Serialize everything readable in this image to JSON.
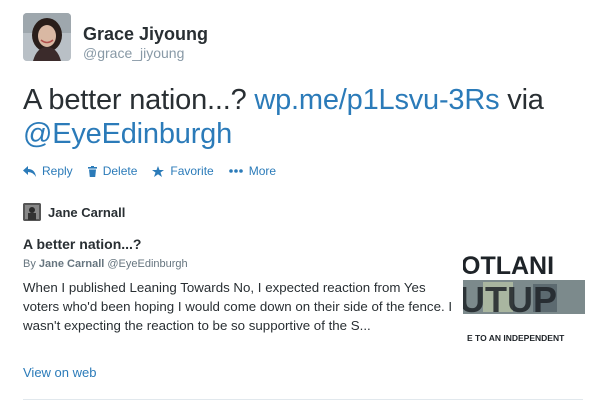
{
  "author": {
    "name": "Grace Jiyoung",
    "handle": "@grace_jiyoung"
  },
  "tweet": {
    "text_plain": "A better nation...? ",
    "link": "wp.me/p1Lsvu-3Rs",
    "via": " via ",
    "mention": "@EyeEdinburgh"
  },
  "actions": [
    {
      "label": "Reply",
      "icon": "reply-icon"
    },
    {
      "label": "Delete",
      "icon": "trash-icon"
    },
    {
      "label": "Favorite",
      "icon": "star-icon"
    },
    {
      "label": "More",
      "icon": "more-dots-icon"
    }
  ],
  "card": {
    "author_name": "Jane Carnall",
    "title": "A better nation...?",
    "byline_prefix": "By ",
    "byline_author": "Jane Carnall",
    "byline_handle": " @EyeEdinburgh",
    "summary": "When I published Leaning Towards No, I expected reaction from Yes voters who'd been hoping I would come down on their side of the fence. I wasn't expecting the reaction to be so supportive of the S...",
    "image_text_top": "OTLANI",
    "image_text_mid": "UTUP",
    "image_text_bottom": "E TO AN INDEPENDENT",
    "view_on_web": "View on web"
  },
  "colors": {
    "link": "#2b7bb9",
    "text": "#292f33",
    "muted": "#8899a6",
    "divider": "#e1e8ed"
  }
}
